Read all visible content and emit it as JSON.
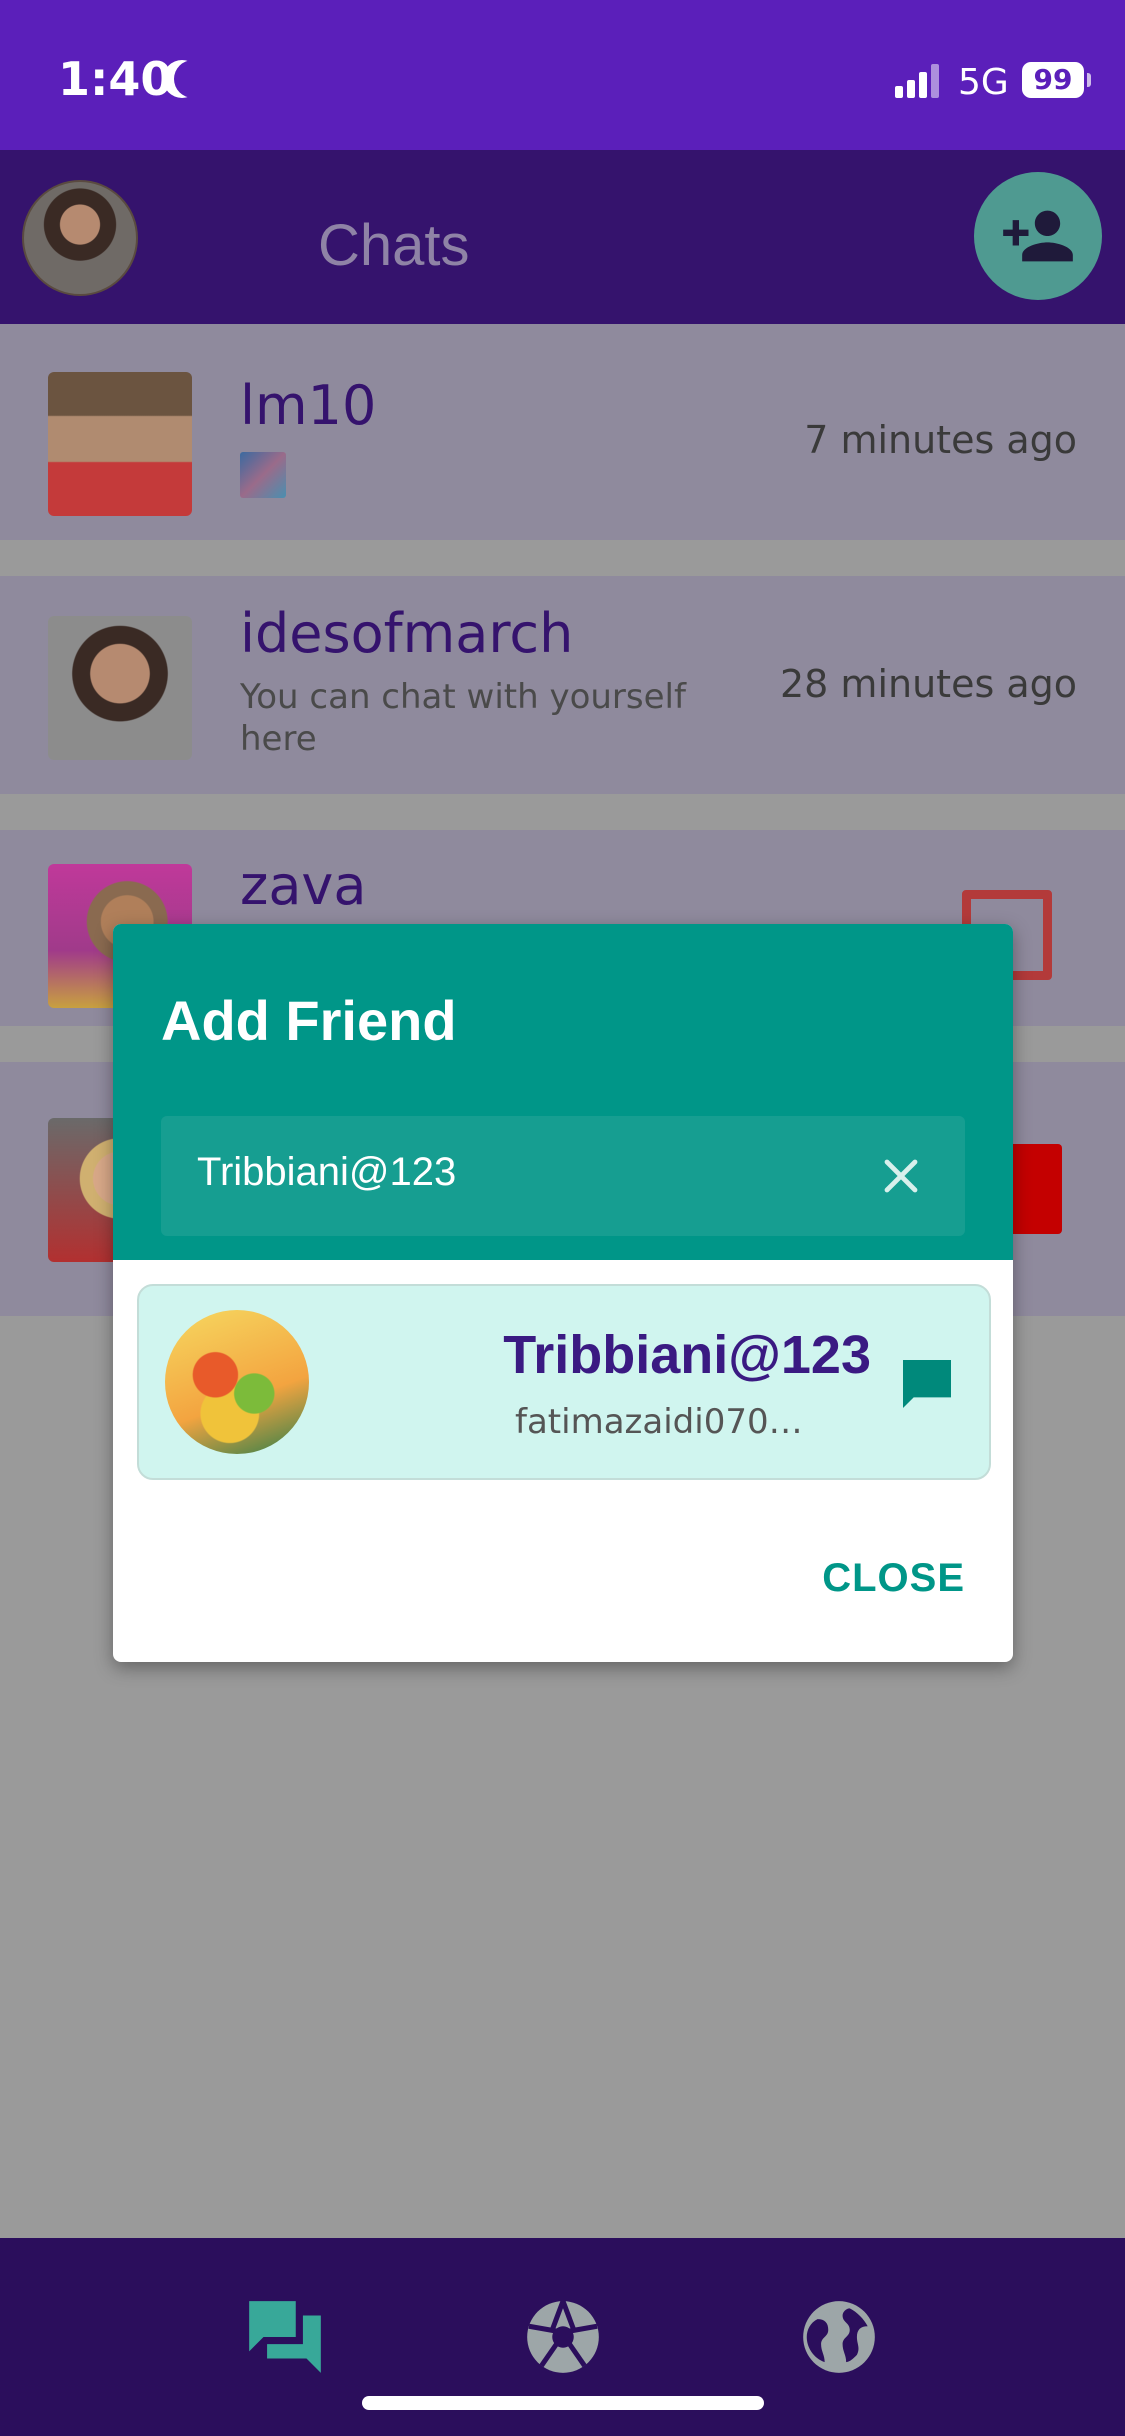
{
  "status_bar": {
    "time": "1:40",
    "network": "5G",
    "battery": "99"
  },
  "app_bar": {
    "title": "Chats"
  },
  "chats": [
    {
      "name": "lm10",
      "subtitle": "",
      "time": "7 minutes ago"
    },
    {
      "name": "idesofmarch",
      "subtitle": "You can chat with yourself here",
      "time": "28 minutes ago"
    },
    {
      "name": "zava",
      "subtitle": "",
      "time": ""
    },
    {
      "name": "",
      "subtitle": "",
      "time": ""
    }
  ],
  "dialog": {
    "title": "Add Friend",
    "search_value": "Tribbiani@123",
    "result": {
      "name": "Tribbiani@123",
      "email": "fatimazaidi0706..."
    },
    "close_label": "CLOSE"
  },
  "colors": {
    "primary": "#5b1fba",
    "accent": "#009688",
    "nav": "#2b0e5c"
  }
}
